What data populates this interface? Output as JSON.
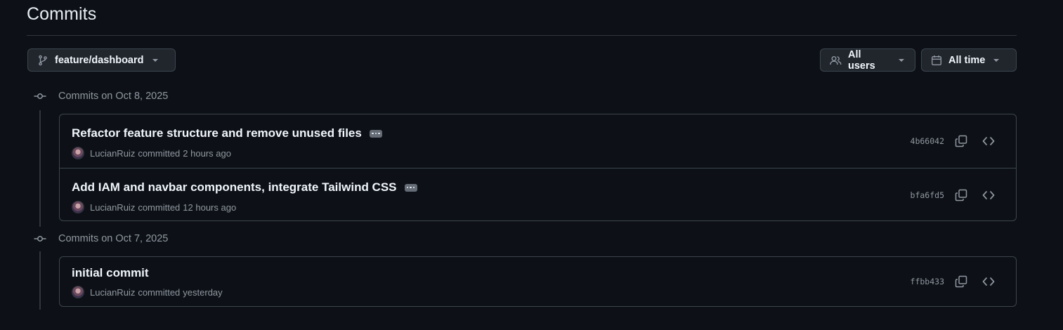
{
  "page": {
    "title": "Commits"
  },
  "filters": {
    "branch": {
      "label": "feature/dashboard",
      "icon": "git-branch-icon"
    },
    "users": {
      "label": "All users",
      "icon": "people-icon"
    },
    "time": {
      "label": "All time",
      "icon": "calendar-icon"
    }
  },
  "groups": [
    {
      "heading": "Commits on Oct 8, 2025",
      "commits": [
        {
          "message": "Refactor feature structure and remove unused files",
          "author": "LucianRuiz",
          "verb": "committed",
          "time": "2 hours ago",
          "sha": "4b66042",
          "has_ellipsis": true
        },
        {
          "message": "Add IAM and navbar components, integrate Tailwind CSS",
          "author": "LucianRuiz",
          "verb": "committed",
          "time": "12 hours ago",
          "sha": "bfa6fd5",
          "has_ellipsis": true
        }
      ]
    },
    {
      "heading": "Commits on Oct 7, 2025",
      "commits": [
        {
          "message": "initial commit",
          "author": "LucianRuiz",
          "verb": "committed",
          "time": "yesterday",
          "sha": "ffbb433",
          "has_ellipsis": false
        }
      ]
    }
  ],
  "colors": {
    "background": "#0d1117",
    "border": "#3d444d",
    "muted_text": "#9198a1",
    "primary_text": "#f0f6fc"
  }
}
